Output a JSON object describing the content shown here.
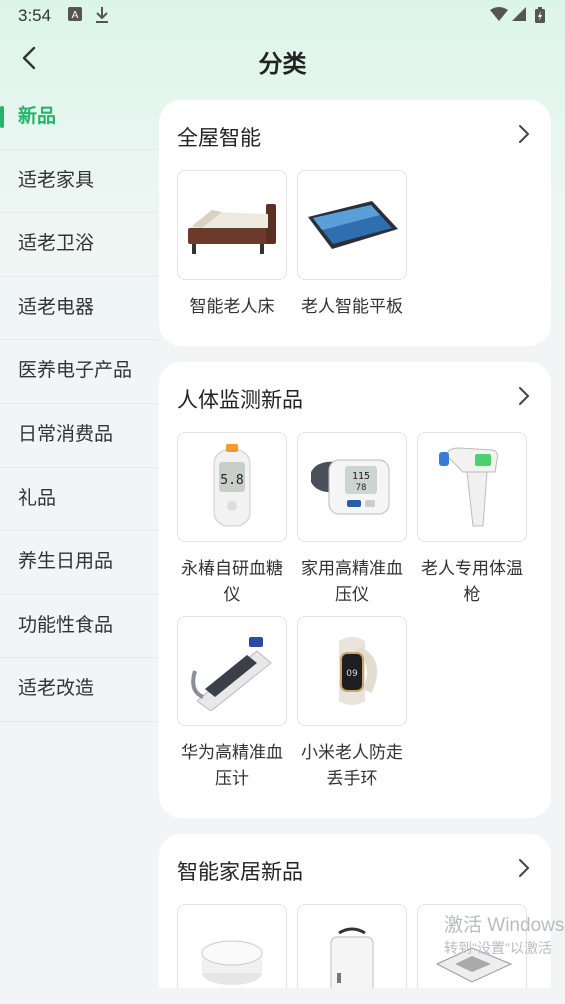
{
  "status": {
    "time": "3:54"
  },
  "header": {
    "title": "分类"
  },
  "sidebar": {
    "items": [
      {
        "label": "新品"
      },
      {
        "label": "适老家具"
      },
      {
        "label": "适老卫浴"
      },
      {
        "label": "适老电器"
      },
      {
        "label": "医养电子产品"
      },
      {
        "label": "日常消费品"
      },
      {
        "label": "礼品"
      },
      {
        "label": "养生日用品"
      },
      {
        "label": "功能性食品"
      },
      {
        "label": "适老改造"
      }
    ]
  },
  "sections": [
    {
      "title": "全屋智能",
      "products": [
        {
          "name": "智能老人床",
          "icon": "bed-icon"
        },
        {
          "name": "老人智能平板",
          "icon": "tablet-icon"
        }
      ]
    },
    {
      "title": "人体监测新品",
      "products": [
        {
          "name": "永椿自研血糖仪",
          "icon": "glucose-meter-icon"
        },
        {
          "name": "家用高精准血压仪",
          "icon": "blood-pressure-monitor-icon"
        },
        {
          "name": "老人专用体温枪",
          "icon": "thermometer-gun-icon"
        },
        {
          "name": "华为高精准血压计",
          "icon": "bp-watch-icon"
        },
        {
          "name": "小米老人防走丢手环",
          "icon": "smart-band-icon"
        }
      ]
    },
    {
      "title": "智能家居新品",
      "products": [
        {
          "name": "",
          "icon": "round-device-icon"
        },
        {
          "name": "",
          "icon": "white-box-icon"
        },
        {
          "name": "",
          "icon": "ceiling-ac-icon"
        }
      ]
    }
  ],
  "watermark": {
    "line1": "激活 Windows",
    "line2": "转到\"设置\"以激活"
  }
}
